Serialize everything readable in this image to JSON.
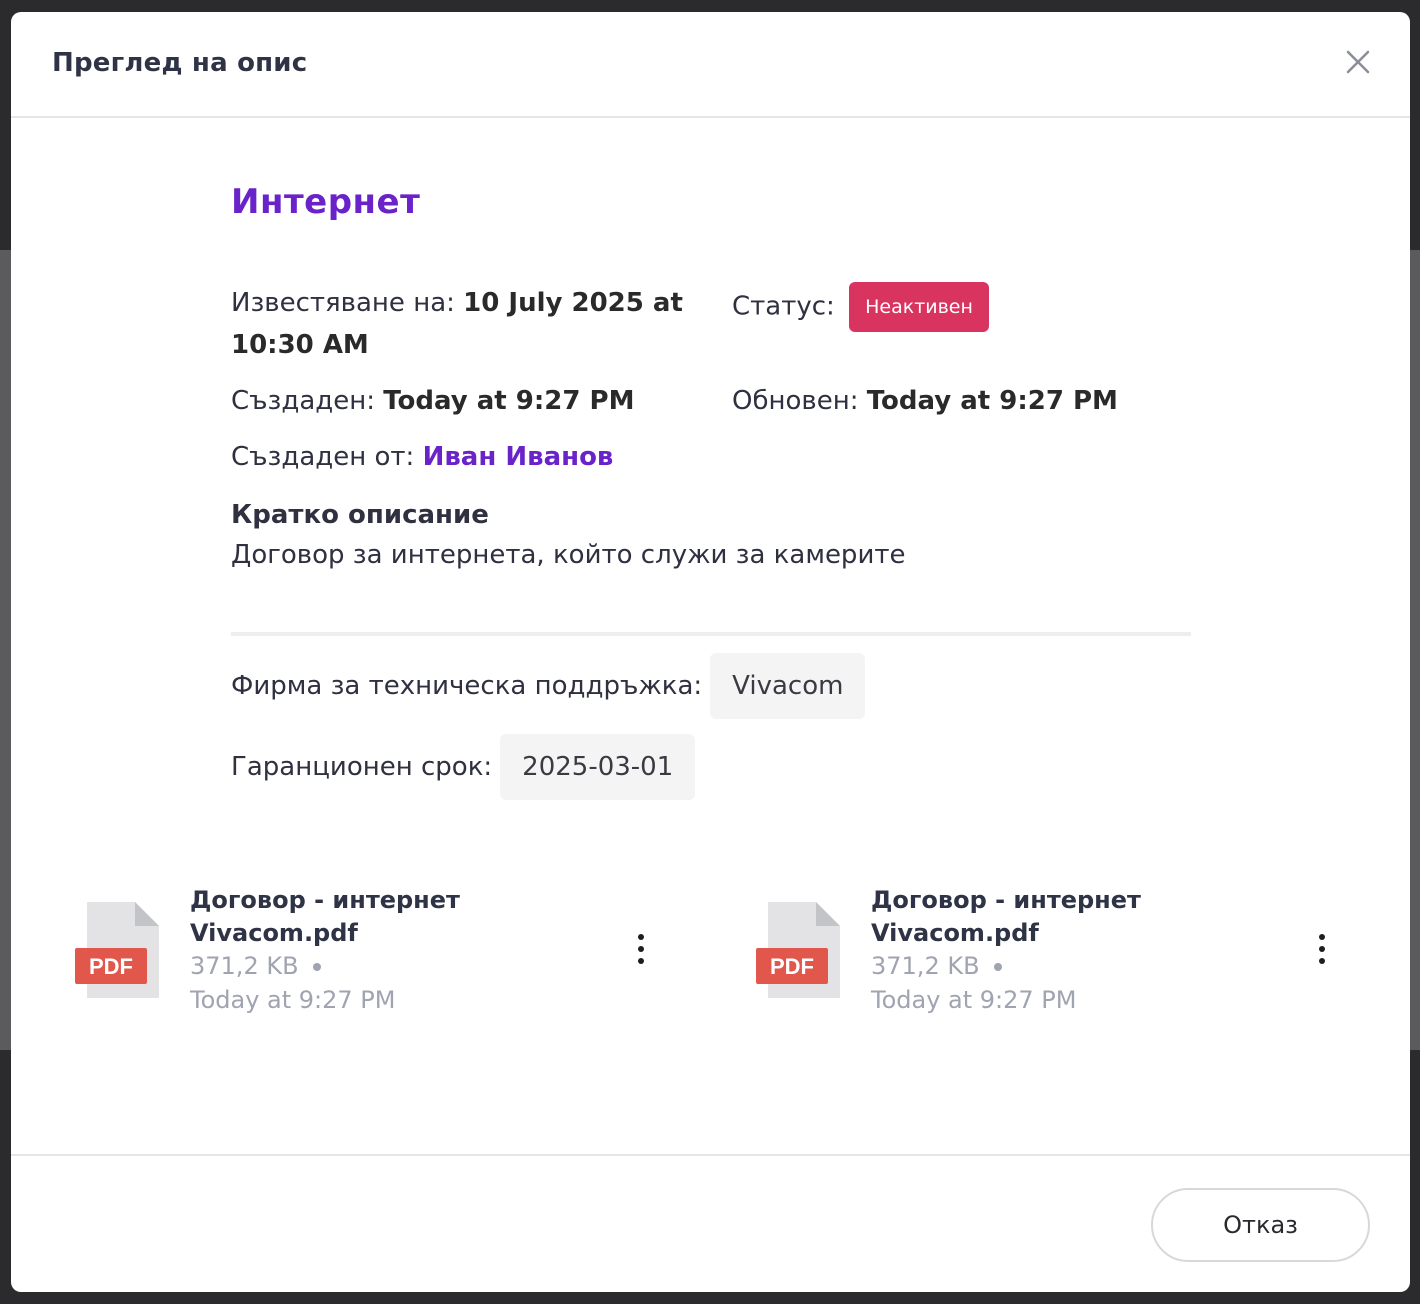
{
  "modal": {
    "title": "Преглед на опис",
    "close_icon": "close-icon"
  },
  "asset": {
    "title": "Интернет",
    "notification_label": "Известяване на:",
    "notification_value_line1": "10 July 2025 at",
    "notification_value_line2": "10:30 AM",
    "status_label": "Статус:",
    "status_value": "Неактивен",
    "created_label": "Създаден:",
    "created_value": "Today at 9:27 PM",
    "updated_label": "Обновен:",
    "updated_value": "Today at 9:27 PM",
    "created_by_label": "Създаден от:",
    "created_by_value": "Иван Иванов",
    "desc_title": "Кратко описание",
    "desc_text": "Договор за интернета, който служи за камерите"
  },
  "fields": {
    "maintenance_label": "Фирма за техническа поддръжка:",
    "maintenance_value": "Vivacom",
    "warranty_label": "Гаранционен срок:",
    "warranty_value": "2025-03-01"
  },
  "files": [
    {
      "name_line1": "Договор - интернет",
      "name_line2": "Vivacom.pdf",
      "size": "371,2 KB",
      "date": "Today at 9:27 PM",
      "type": "PDF"
    },
    {
      "name_line1": "Договор - интернет",
      "name_line2": "Vivacom.pdf",
      "size": "371,2 KB",
      "date": "Today at 9:27 PM",
      "type": "PDF"
    }
  ],
  "footer": {
    "cancel_label": "Отказ"
  },
  "colors": {
    "accent": "#6a22c9",
    "status_inactive": "#d9345f",
    "pdf_red": "#e2574c"
  }
}
